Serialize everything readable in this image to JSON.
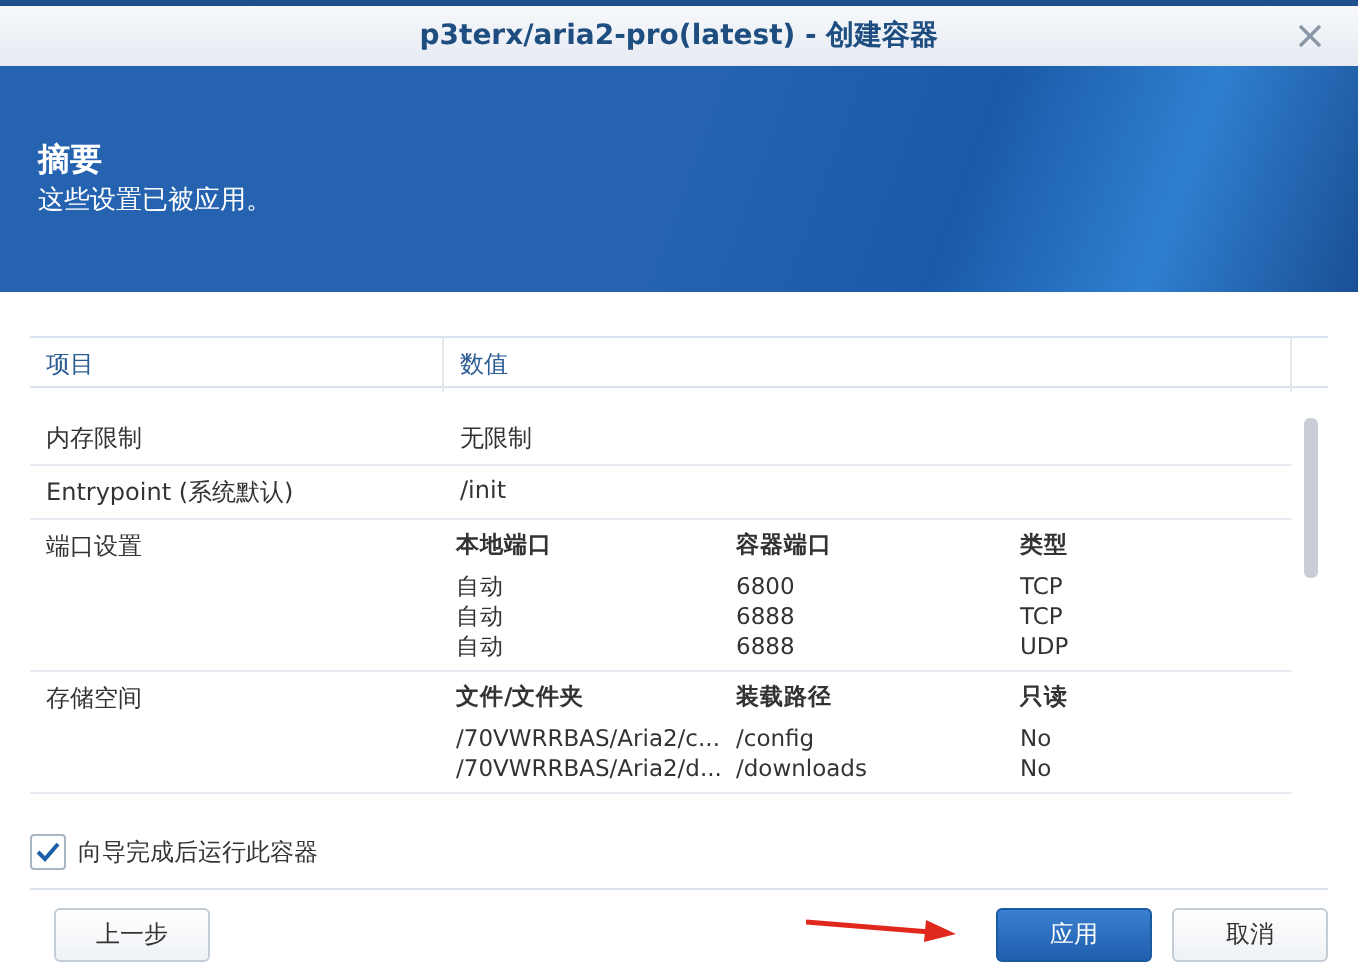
{
  "window": {
    "title": "p3terx/aria2-pro(latest) - 创建容器"
  },
  "banner": {
    "title": "摘要",
    "subtitle": "这些设置已被应用。"
  },
  "table": {
    "columns": [
      "项目",
      "数值"
    ],
    "rows": [
      {
        "kind": "text",
        "item": "内存限制",
        "value": "无限制"
      },
      {
        "kind": "text",
        "item": "Entrypoint (系统默认)",
        "value": "/init"
      },
      {
        "kind": "grid",
        "item": "端口设置",
        "headers": [
          "本地端口",
          "容器端口",
          "类型"
        ],
        "lines": [
          [
            "自动",
            "6800",
            "TCP"
          ],
          [
            "自动",
            "6888",
            "TCP"
          ],
          [
            "自动",
            "6888",
            "UDP"
          ]
        ]
      },
      {
        "kind": "grid",
        "item": "存储空间",
        "headers": [
          "文件/文件夹",
          "装载路径",
          "只读"
        ],
        "lines": [
          [
            "/70VWRRBAS/Aria2/c...",
            "/config",
            "No"
          ],
          [
            "/70VWRRBAS/Aria2/d...",
            "/downloads",
            "No"
          ]
        ]
      }
    ]
  },
  "run_after": {
    "label": "向导完成后运行此容器",
    "checked": true
  },
  "buttons": {
    "back": "上一步",
    "apply": "应用",
    "cancel": "取消"
  }
}
